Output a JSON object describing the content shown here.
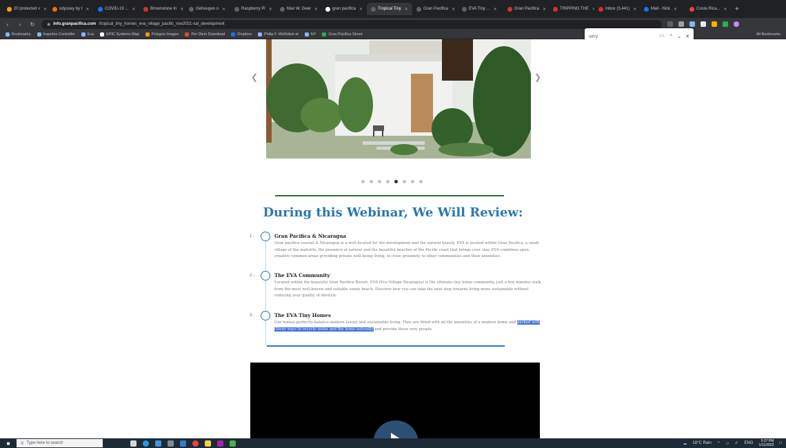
{
  "browser": {
    "tabs": [
      {
        "label": "20 protected v",
        "color": "#f4a01a"
      },
      {
        "label": "odyssey by t",
        "color": "#e8710a"
      },
      {
        "label": "COVID-19 ...",
        "color": "#1a73e8"
      },
      {
        "label": "Brownstone In",
        "color": "#d93025"
      },
      {
        "label": "Geheugen o",
        "color": "#5f6368"
      },
      {
        "label": "Raspberry Pi",
        "color": "#5f6368"
      },
      {
        "label": "Max W. Geer",
        "color": "#5f6368"
      },
      {
        "label": "gran pacifica",
        "color": "#ffffff"
      },
      {
        "label": "Tropical Tiny",
        "color": "#5f6368",
        "active": true
      },
      {
        "label": "Gran Pacifica",
        "color": "#5f6368"
      },
      {
        "label": "EVA Tiny ...",
        "color": "#5f6368"
      },
      {
        "label": "Gran Pacifica",
        "color": "#d93025"
      },
      {
        "label": "TRIPPING THE",
        "color": "#d93025"
      },
      {
        "label": "Inbox (3,441)",
        "color": "#d93025"
      },
      {
        "label": "Mail - Nick",
        "color": "#1a73e8"
      },
      {
        "label": "Costa Rica...",
        "color": "#e8453c"
      }
    ],
    "new_tab": "+",
    "url_host": "info.granpacifica.com",
    "url_path": "/tropical_tiny_homes_eva_village_pacific_nov2021-sal_development",
    "bookmarks": [
      {
        "label": "Bookmarks",
        "color": "#8ab4f8"
      },
      {
        "label": "Inquiries Controller",
        "color": "#8ab4f8"
      },
      {
        "label": "Eva",
        "color": "#8ab4f8"
      },
      {
        "label": "EPIC Systems Map",
        "color": "#ffffff"
      },
      {
        "label": "Polygon Images",
        "color": "#f29900"
      },
      {
        "label": "Per Diem Download",
        "color": "#e8453c"
      },
      {
        "label": "Dropbox",
        "color": "#1a73e8"
      },
      {
        "label": "Philip F. WeRobot at",
        "color": "#8ab4f8"
      },
      {
        "label": "NY",
        "color": "#8ab4f8"
      },
      {
        "label": "Gran Pacifica Street",
        "color": "#34a853"
      }
    ],
    "other_bookmarks": "All Bookmarks",
    "find": {
      "query": "very",
      "count": "1/1"
    }
  },
  "page": {
    "heading": "During this Webinar, We Will Review:",
    "carousel": {
      "dot_count": 8,
      "active_index": 4
    },
    "items": [
      {
        "num": "1 -",
        "title": "Gran Pacifica & Nicaragua",
        "desc": "Gran pacifica coastal & Nicaragua is a well-located for the development and the natural beauty. EVA is located within Gran Pacifica, a small village of the maturity, the presence of natural and the beautiful beaches of the Pacific coast that brings your stay. EVA combines open, creative common areas providing private well-being living, in close proximity to other communities and their amenities."
      },
      {
        "num": "2 -",
        "title": "The EVA Community",
        "desc": "Located within the beautiful Gran Pacifica Resort, EVA (Eco Village Nicaragua) is the ultimate tiny home community, just a few minutes walk from the most well-known and suitable sunny beach. Discover how you can take the next step towards living more sustainably without reducing your quality of lifestyle."
      },
      {
        "num": "3 -",
        "title": "The EVA Tiny Homes",
        "desc_pre": "Our homes perfectly balance modern luxury and sustainable living. They are fitted with all the amenities of a modern home and ",
        "desc_hl": "packed with clever ways to recycle water and the home naturally",
        "desc_post": " and provide these very people."
      }
    ]
  },
  "taskbar": {
    "search_placeholder": "Type here to search",
    "weather": "18°C Rain",
    "lang": "ENG",
    "time": "5:37 PM",
    "date": "1/11/2022"
  }
}
